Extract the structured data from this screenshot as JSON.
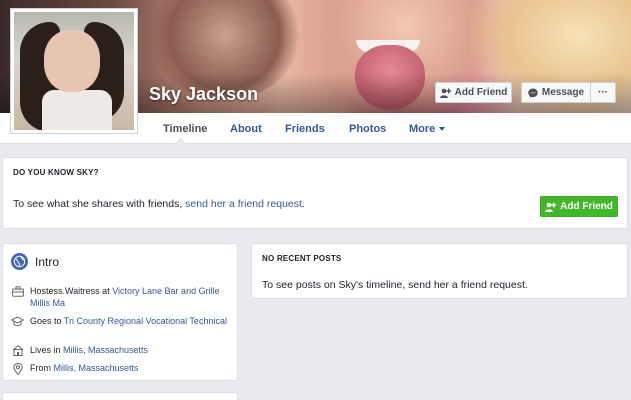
{
  "profile": {
    "name": "Sky Jackson"
  },
  "cover_actions": {
    "add_friend": "Add Friend",
    "message": "Message",
    "more": "···"
  },
  "nav": {
    "tabs": [
      "Timeline",
      "About",
      "Friends",
      "Photos",
      "More"
    ],
    "active": "Timeline"
  },
  "know_card": {
    "header": "DO YOU KNOW SKY?",
    "text_before": "To see what she shares with friends, ",
    "link": "send her a friend request.",
    "button": "Add Friend"
  },
  "intro": {
    "title": "Intro",
    "items": [
      {
        "icon": "briefcase-icon",
        "prefix": "Hostess.Waitress at ",
        "link": "Victory Lane Bar and Grille Millis Ma"
      },
      {
        "icon": "graduation-cap-icon",
        "prefix": "Goes to ",
        "link": "Tri County Regional Vocational Technical"
      },
      {
        "icon": "house-icon",
        "prefix": "Lives in ",
        "link": "Millis, Massachusetts"
      },
      {
        "icon": "location-pin-icon",
        "prefix": "From ",
        "link": "Millis, Massachusetts"
      }
    ]
  },
  "posts_card": {
    "header": "NO RECENT POSTS",
    "text": "To see posts on Sky's timeline, send her a friend request."
  },
  "colors": {
    "link": "#365899",
    "green": "#42b72a",
    "background": "#e9ebee"
  }
}
